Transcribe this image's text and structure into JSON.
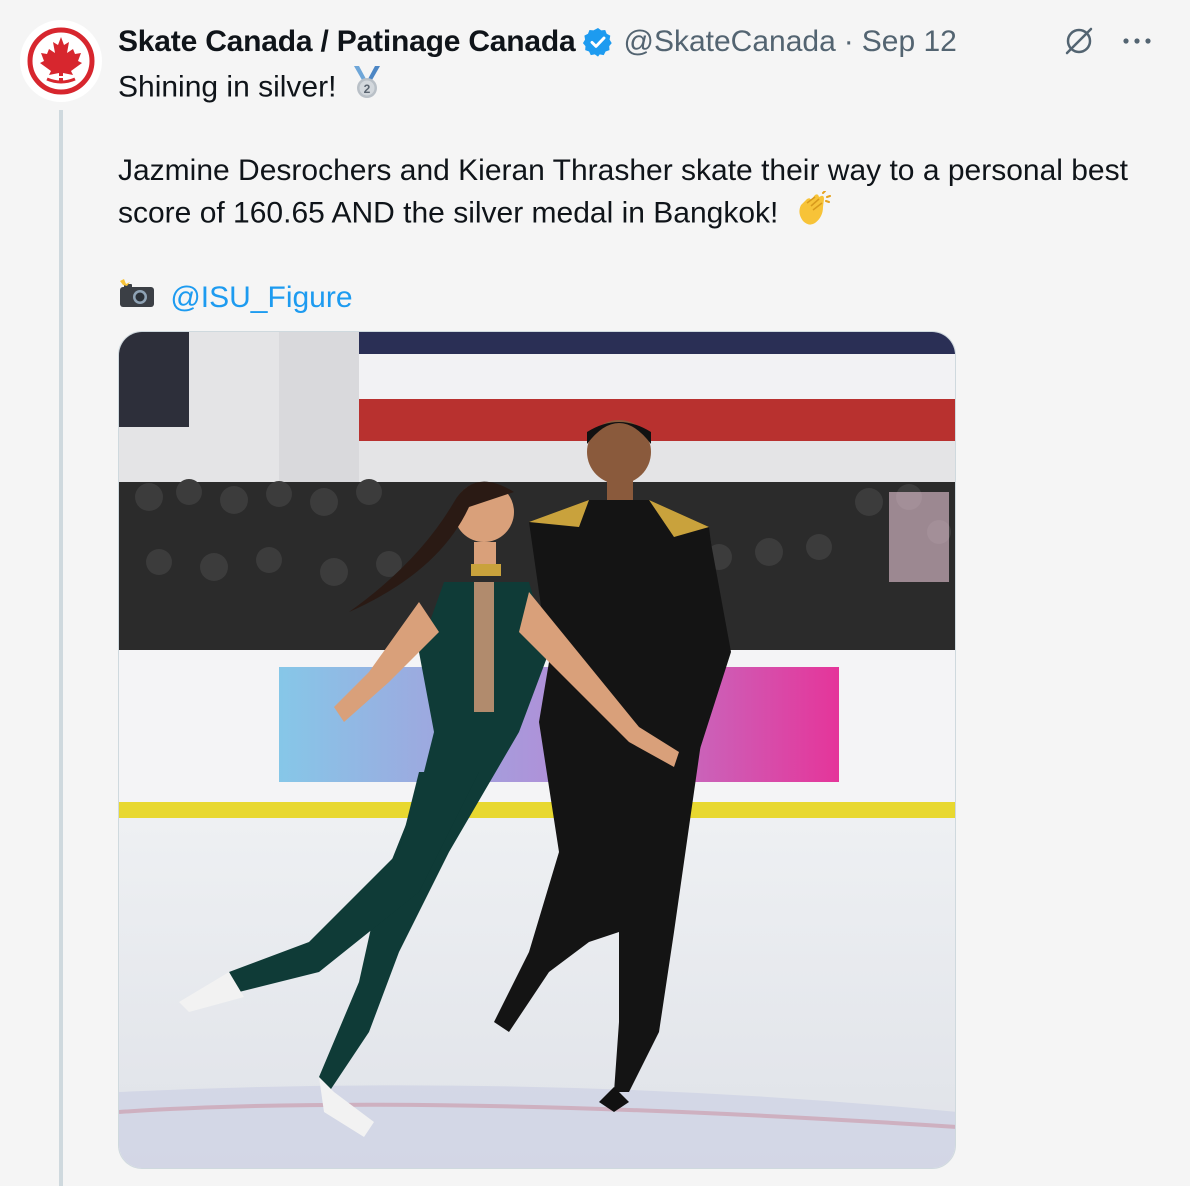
{
  "account": {
    "display_name": "Skate Canada / Patinage Canada",
    "handle": "@SkateCanada",
    "separator": "·",
    "date": "Sep 12",
    "avatar_icon": "skate-canada-maple-leaf-logo",
    "verified_icon": "verified-badge-icon"
  },
  "top_actions": {
    "grok_icon": "grok-icon",
    "more_icon": "more-icon",
    "more_label": "···"
  },
  "tweet": {
    "line1": "Shining in silver!",
    "line1_emoji": "silver-medal-2-emoji",
    "line2": "Jazmine Desrochers and Kieran Thrasher skate their way to a personal best",
    "line3": "score of 160.65 AND the silver medal in Bangkok!",
    "line3_emoji": "clapping-hands-emoji",
    "credit_emoji": "camera-flash-emoji",
    "mention": "@ISU_Figure"
  },
  "media": {
    "description_icon": "ice-dance-photo",
    "colors": {
      "banner_red": "#b8312f",
      "banner_navy": "#2a2f55",
      "rink_yellow": "#e8d830",
      "ad_blue": "#86c7e8",
      "ad_pink": "#e5359a",
      "costume_green": "#0f3b37",
      "costume_black": "#141414",
      "gold": "#c9a23c"
    }
  },
  "colors": {
    "link": "#1d9bf0",
    "secondary_text": "#536471",
    "verified": "#1d9bf0",
    "background": "#f5f5f5"
  }
}
